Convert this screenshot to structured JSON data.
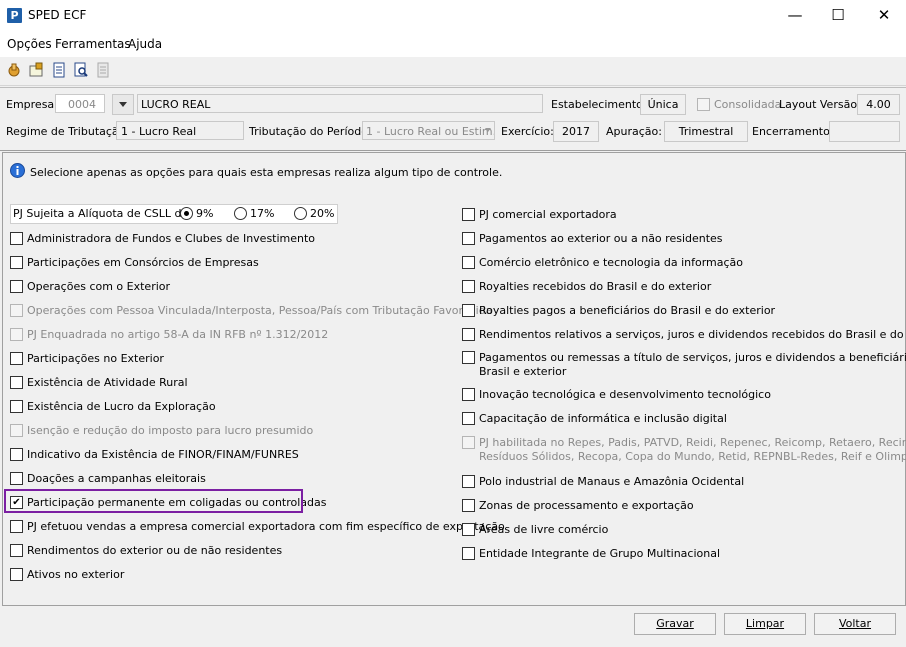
{
  "window": {
    "title": "SPED ECF",
    "minimize": "—",
    "maximize": "☐",
    "close": "✕"
  },
  "menu": [
    "Opções",
    "Ferramentas",
    "Ajuda"
  ],
  "toolbar_icons": [
    "hand-icon",
    "settings-icon",
    "document-icon",
    "search-document-icon",
    "disabled-doc-icon"
  ],
  "header": {
    "empresa_label": "Empresa:",
    "empresa_code": "0004",
    "empresa_name": "LUCRO REAL",
    "estabelecimento_label": "Estabelecimento:",
    "estabelecimento_value": "Única",
    "consolidada_label": "Consolidada",
    "layout_label": "Layout Versão:",
    "layout_value": "4.00",
    "regime_label": "Regime de Tributação:",
    "regime_value": "1 - Lucro Real",
    "tributacao_label": "Tributação do Período:",
    "tributacao_value": "1 - Lucro Real ou Estim.",
    "exercicio_label": "Exercício:",
    "exercicio_value": "2017",
    "apuracao_label": "Apuração:",
    "apuracao_value": "Trimestral",
    "encerramento_label": "Encerramento:",
    "encerramento_value": ""
  },
  "info_text": "Selecione apenas as opções para quais esta  empresas realiza algum tipo de controle.",
  "csll": {
    "label": "PJ Sujeita a Alíquota de CSLL de:",
    "options": [
      "9%",
      "17%",
      "20%"
    ],
    "selected": "9%"
  },
  "left_options": [
    {
      "label": "Administradora de Fundos e Clubes de Investimento",
      "checked": false,
      "disabled": false
    },
    {
      "label": "Participações em Consórcios de Empresas",
      "checked": false,
      "disabled": false
    },
    {
      "label": "Operações com o Exterior",
      "checked": false,
      "disabled": false
    },
    {
      "label": "Operações com Pessoa Vinculada/Interposta, Pessoa/País com Tributação Favorecida",
      "checked": false,
      "disabled": true
    },
    {
      "label": "PJ Enquadrada no artigo 58-A da IN RFB nº 1.312/2012",
      "checked": false,
      "disabled": true
    },
    {
      "label": "Participações no Exterior",
      "checked": false,
      "disabled": false
    },
    {
      "label": "Existência de Atividade Rural",
      "checked": false,
      "disabled": false
    },
    {
      "label": "Existência de Lucro da Exploração",
      "checked": false,
      "disabled": false
    },
    {
      "label": "Isenção e redução do imposto para lucro presumido",
      "checked": false,
      "disabled": true
    },
    {
      "label": "Indicativo da Existência de FINOR/FINAM/FUNRES",
      "checked": false,
      "disabled": false
    },
    {
      "label": "Doações a campanhas eleitorais",
      "checked": false,
      "disabled": false
    },
    {
      "label": "Participação permanente em coligadas ou controladas",
      "checked": true,
      "disabled": false
    },
    {
      "label": "PJ efetuou vendas a empresa comercial exportadora com fim específico de exportação",
      "checked": false,
      "disabled": false
    },
    {
      "label": "Rendimentos do exterior ou de não residentes",
      "checked": false,
      "disabled": false
    },
    {
      "label": "Ativos no exterior",
      "checked": false,
      "disabled": false
    }
  ],
  "right_options": [
    {
      "label": "PJ comercial exportadora",
      "checked": false,
      "disabled": false
    },
    {
      "label": "Pagamentos ao exterior ou a não residentes",
      "checked": false,
      "disabled": false
    },
    {
      "label": "Comércio eletrônico e tecnologia da informação",
      "checked": false,
      "disabled": false
    },
    {
      "label": "Royalties recebidos do Brasil e do exterior",
      "checked": false,
      "disabled": false
    },
    {
      "label": "Royalties pagos a beneficiários do Brasil e do exterior",
      "checked": false,
      "disabled": false
    },
    {
      "label": "Rendimentos relativos a serviços, juros e dividendos recebidos do Brasil e do exterior",
      "checked": false,
      "disabled": false
    },
    {
      "label": "Pagamentos ou remessas a título de serviços, juros e dividendos a beneficiários do",
      "label2": "Brasil e exterior",
      "checked": false,
      "disabled": false
    },
    {
      "label": "Inovação tecnológica e desenvolvimento tecnológico",
      "checked": false,
      "disabled": false
    },
    {
      "label": "Capacitação de informática e inclusão digital",
      "checked": false,
      "disabled": false
    },
    {
      "label": "PJ habilitada no Repes, Padis, PATVD, Reidi, Repenec, Reicomp, Retaero, Recine,",
      "label2": "Resíduos Sólidos, Recopa, Copa do Mundo, Retid, REPNBL-Redes, Reif e Olimpíadas",
      "checked": false,
      "disabled": true
    },
    {
      "label": "Polo industrial de Manaus e Amazônia Ocidental",
      "checked": false,
      "disabled": false
    },
    {
      "label": "Zonas de processamento e exportação",
      "checked": false,
      "disabled": false
    },
    {
      "label": "Áreas de livre comércio",
      "checked": false,
      "disabled": false
    },
    {
      "label": "Entidade Integrante de Grupo Multinacional",
      "checked": false,
      "disabled": false
    }
  ],
  "buttons": {
    "gravar": "Gravar",
    "limpar": "Limpar",
    "voltar": "Voltar"
  }
}
